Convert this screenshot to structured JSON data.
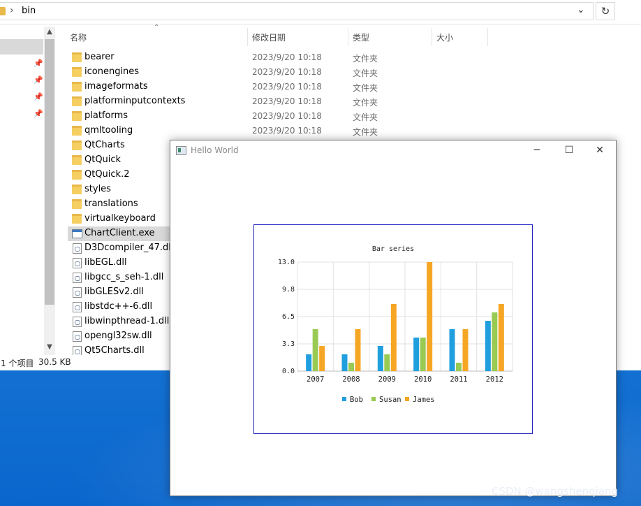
{
  "explorer": {
    "path": "bin",
    "columns": {
      "name": "名称",
      "date": "修改日期",
      "type": "类型",
      "size": "大小"
    },
    "files": [
      {
        "name": "bearer",
        "date": "2023/9/20 10:18",
        "type": "文件夹",
        "icon": "folder-icon"
      },
      {
        "name": "iconengines",
        "date": "2023/9/20 10:18",
        "type": "文件夹",
        "icon": "folder-icon"
      },
      {
        "name": "imageformats",
        "date": "2023/9/20 10:18",
        "type": "文件夹",
        "icon": "folder-icon"
      },
      {
        "name": "platforminputcontexts",
        "date": "2023/9/20 10:18",
        "type": "文件夹",
        "icon": "folder-icon"
      },
      {
        "name": "platforms",
        "date": "2023/9/20 10:18",
        "type": "文件夹",
        "icon": "folder-icon"
      },
      {
        "name": "qmltooling",
        "date": "2023/9/20 10:18",
        "type": "文件夹",
        "icon": "folder-icon"
      },
      {
        "name": "QtCharts",
        "date": "",
        "type": "",
        "icon": "folder-icon"
      },
      {
        "name": "QtQuick",
        "date": "",
        "type": "",
        "icon": "folder-icon"
      },
      {
        "name": "QtQuick.2",
        "date": "",
        "type": "",
        "icon": "folder-icon"
      },
      {
        "name": "styles",
        "date": "",
        "type": "",
        "icon": "folder-icon"
      },
      {
        "name": "translations",
        "date": "",
        "type": "",
        "icon": "folder-icon"
      },
      {
        "name": "virtualkeyboard",
        "date": "",
        "type": "",
        "icon": "folder-icon"
      },
      {
        "name": "ChartClient.exe",
        "date": "",
        "type": "",
        "icon": "exe-icon",
        "selected": true
      },
      {
        "name": "D3Dcompiler_47.dll",
        "date": "",
        "type": "",
        "icon": "dll-icon"
      },
      {
        "name": "libEGL.dll",
        "date": "",
        "type": "",
        "icon": "dll-icon"
      },
      {
        "name": "libgcc_s_seh-1.dll",
        "date": "",
        "type": "",
        "icon": "dll-icon"
      },
      {
        "name": "libGLESv2.dll",
        "date": "",
        "type": "",
        "icon": "dll-icon"
      },
      {
        "name": "libstdc++-6.dll",
        "date": "",
        "type": "",
        "icon": "dll-icon"
      },
      {
        "name": "libwinpthread-1.dll",
        "date": "",
        "type": "",
        "icon": "dll-icon"
      },
      {
        "name": "opengl32sw.dll",
        "date": "",
        "type": "",
        "icon": "dll-icon"
      },
      {
        "name": "Qt5Charts.dll",
        "date": "",
        "type": "",
        "icon": "dll-icon"
      }
    ],
    "status": {
      "selection": "1 个项目",
      "size": "30.5 KB"
    }
  },
  "qt_window": {
    "title": "Hello World",
    "buttons": {
      "minimize": "─",
      "maximize": "☐",
      "close": "✕"
    }
  },
  "chart_data": {
    "type": "bar",
    "title": "Bar series",
    "categories": [
      "2007",
      "2008",
      "2009",
      "2010",
      "2011",
      "2012"
    ],
    "series": [
      {
        "name": "Bob",
        "color": "#209fdf",
        "values": [
          2,
          2,
          3,
          4,
          5,
          6
        ]
      },
      {
        "name": "Susan",
        "color": "#99ca53",
        "values": [
          5,
          1,
          2,
          4,
          1,
          7
        ]
      },
      {
        "name": "James",
        "color": "#f6a625",
        "values": [
          3,
          5,
          8,
          13,
          5,
          8
        ]
      }
    ],
    "ylim": [
      0,
      13
    ],
    "yticks": [
      "0.0",
      "3.3",
      "6.5",
      "9.8",
      "13.0"
    ],
    "grid": true,
    "legend": "bottom"
  },
  "watermark": "CSDN @wangshenqiang"
}
